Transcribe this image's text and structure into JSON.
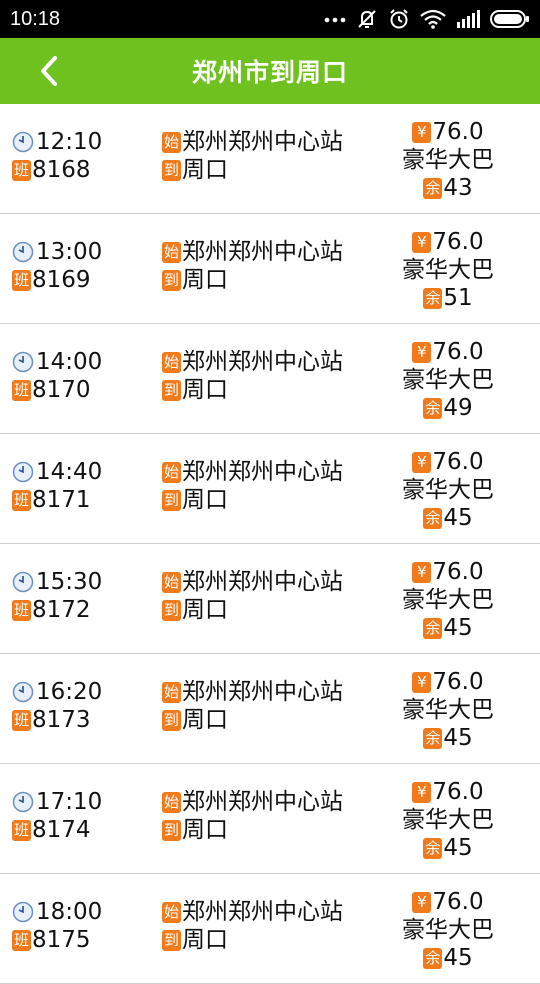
{
  "status_bar": {
    "time": "10:18"
  },
  "header": {
    "title": "郑州市到周口"
  },
  "badges": {
    "shift": "班",
    "start": "始",
    "arrive": "到",
    "price": "¥",
    "remain": "余"
  },
  "trips": [
    {
      "time": "12:10",
      "number": "8168",
      "from": "郑州郑州中心站",
      "to": "周口",
      "price": "76.0",
      "bus_type": "豪华大巴",
      "seats": "43"
    },
    {
      "time": "13:00",
      "number": "8169",
      "from": "郑州郑州中心站",
      "to": "周口",
      "price": "76.0",
      "bus_type": "豪华大巴",
      "seats": "51"
    },
    {
      "time": "14:00",
      "number": "8170",
      "from": "郑州郑州中心站",
      "to": "周口",
      "price": "76.0",
      "bus_type": "豪华大巴",
      "seats": "49"
    },
    {
      "time": "14:40",
      "number": "8171",
      "from": "郑州郑州中心站",
      "to": "周口",
      "price": "76.0",
      "bus_type": "豪华大巴",
      "seats": "45"
    },
    {
      "time": "15:30",
      "number": "8172",
      "from": "郑州郑州中心站",
      "to": "周口",
      "price": "76.0",
      "bus_type": "豪华大巴",
      "seats": "45"
    },
    {
      "time": "16:20",
      "number": "8173",
      "from": "郑州郑州中心站",
      "to": "周口",
      "price": "76.0",
      "bus_type": "豪华大巴",
      "seats": "45"
    },
    {
      "time": "17:10",
      "number": "8174",
      "from": "郑州郑州中心站",
      "to": "周口",
      "price": "76.0",
      "bus_type": "豪华大巴",
      "seats": "45"
    },
    {
      "time": "18:00",
      "number": "8175",
      "from": "郑州郑州中心站",
      "to": "周口",
      "price": "76.0",
      "bus_type": "豪华大巴",
      "seats": "45"
    }
  ],
  "colors": {
    "header_bg": "#6ec11f",
    "badge_bg": "#f07a1c",
    "divider": "#cfcfcf"
  },
  "icons": [
    "back-arrow-icon",
    "clock-icon",
    "more-dots-icon",
    "mute-icon",
    "alarm-icon",
    "wifi-icon",
    "signal-icon",
    "battery-icon"
  ]
}
